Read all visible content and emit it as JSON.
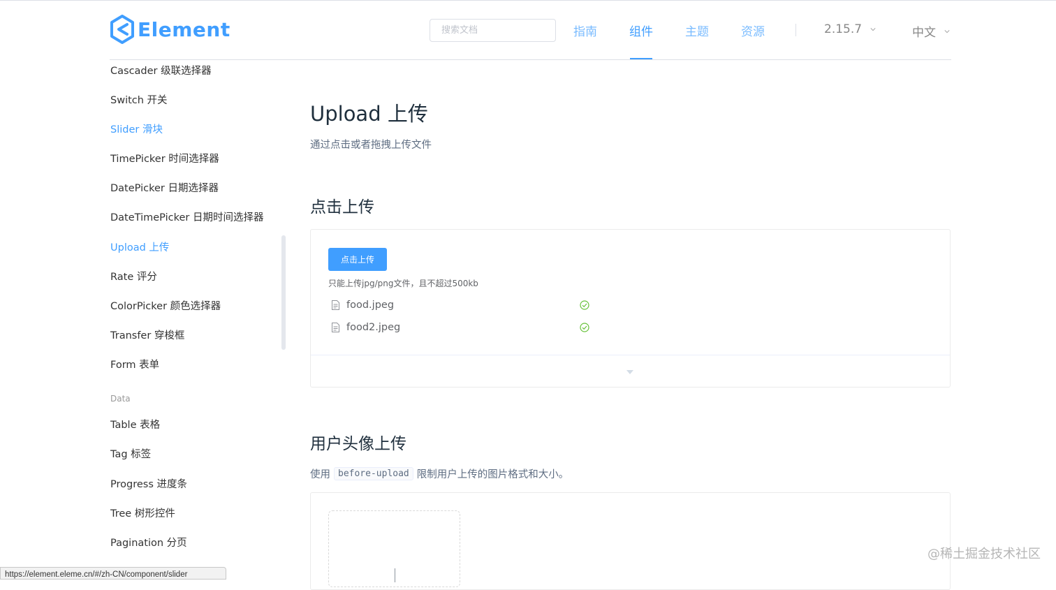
{
  "header": {
    "logo_text": "Element",
    "search_placeholder": "搜索文档",
    "nav": [
      "指南",
      "组件",
      "主题",
      "资源"
    ],
    "version": "2.15.7",
    "language": "中文"
  },
  "sidebar": {
    "items": [
      "Cascader 级联选择器",
      "Switch 开关",
      "Slider 滑块",
      "TimePicker 时间选择器",
      "DatePicker 日期选择器",
      "DateTimePicker 日期时间选择器",
      "Upload 上传",
      "Rate 评分",
      "ColorPicker 颜色选择器",
      "Transfer 穿梭框",
      "Form 表单"
    ],
    "group_data": "Data",
    "data_items": [
      "Table 表格",
      "Tag 标签",
      "Progress 进度条",
      "Tree 树形控件",
      "Pagination 分页"
    ]
  },
  "main": {
    "title": "Upload 上传",
    "description": "通过点击或者拖拽上传文件",
    "section1": {
      "heading": "点击上传",
      "button_label": "点击上传",
      "tip": "只能上传jpg/png文件，且不超过500kb",
      "files": [
        "food.jpeg",
        "food2.jpeg"
      ]
    },
    "section2": {
      "heading": "用户头像上传",
      "text_before": "使用",
      "code": "before-upload",
      "text_after": "限制用户上传的图片格式和大小。"
    }
  },
  "statusbar": {
    "url": "https://element.eleme.cn/#/zh-CN/component/slider"
  },
  "watermark": "@稀土掘金技术社区",
  "colors": {
    "primary": "#409eff",
    "success": "#67c23a",
    "text": "#1f2f3d"
  }
}
